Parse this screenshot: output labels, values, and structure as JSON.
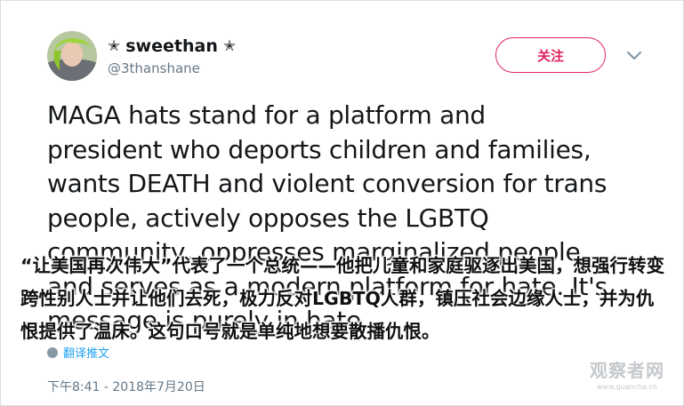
{
  "tweet": {
    "display_name": "sweethan",
    "name_decoration": "✭",
    "handle": "@3thanshane",
    "follow_label": "关注",
    "text": "MAGA hats stand for a platform and\npresident who deports children and families,\nwants DEATH and violent conversion for trans\npeople, actively opposes the LGBTQ\ncommunity, oppresses marginalized people\nand serves as a modern platform for hate. It's\nmessage is purely in hate.",
    "translate_label": "翻译推文",
    "timestamp": "下午8:41 - 2018年7月20日"
  },
  "overlay": {
    "subtitle": "“让美国再次伟大”代表了一个总统——他把儿童和家庭驱逐出美国，想强行转变跨性别人士并让他们去死，极力反对LGBTQ人群，镇压社会边缘人士，并为仇恨提供了温床。这句口号就是单纯地想要散播仇恨。",
    "watermark_cn": "观察者网",
    "watermark_url": "www.guancha.cn"
  },
  "colors": {
    "follow_accent": "#e0245e",
    "secondary_text": "#657786",
    "link": "#1da1f2"
  },
  "icons": {
    "avatar": "profile-photo",
    "menu": "chevron-down-icon",
    "translate": "globe-icon"
  }
}
